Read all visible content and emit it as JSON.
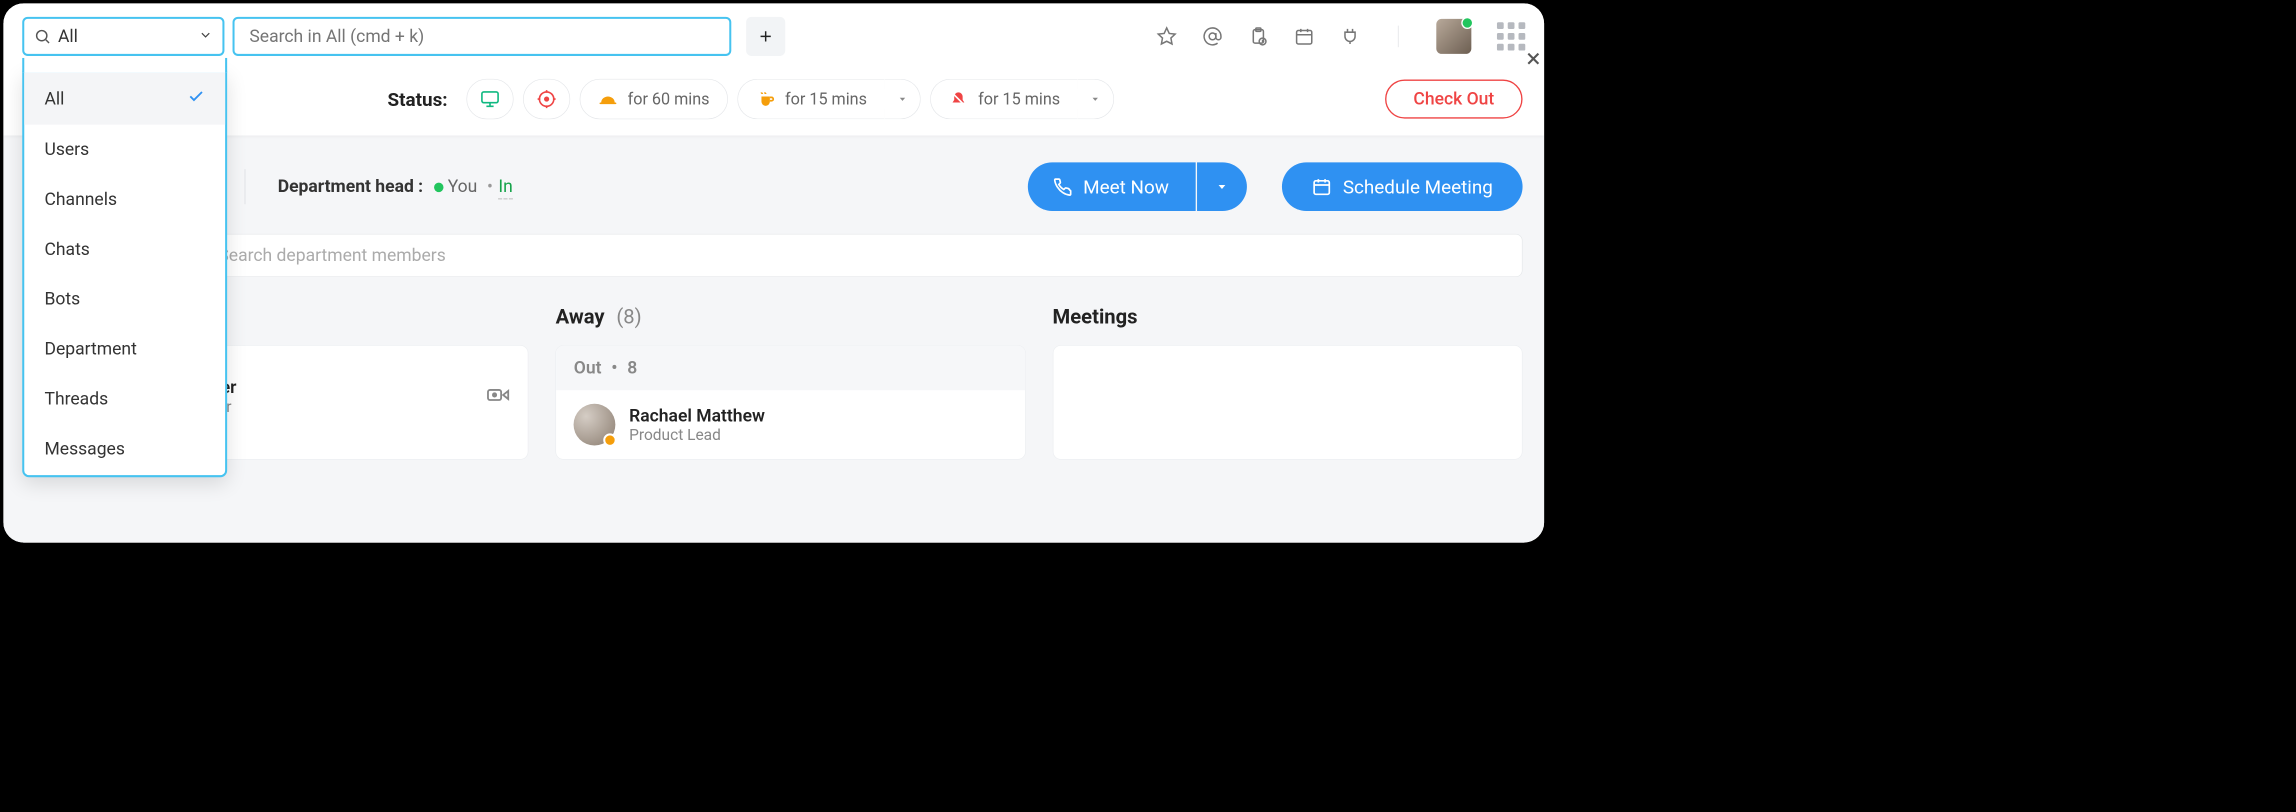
{
  "topbar": {
    "filter_selected": "All",
    "search_placeholder": "Search in All (cmd + k)",
    "dropdown_items": [
      "All",
      "Users",
      "Channels",
      "Chats",
      "Bots",
      "Department",
      "Threads",
      "Messages"
    ]
  },
  "status": {
    "label": "Status:",
    "options": [
      {
        "icon": "monitor",
        "text": ""
      },
      {
        "icon": "target",
        "text": ""
      },
      {
        "icon": "bell",
        "text": "for 60 mins"
      },
      {
        "icon": "coffee",
        "text": "for 15 mins"
      },
      {
        "icon": "notify-off",
        "text": "for 15 mins"
      }
    ],
    "check_out": "Check Out"
  },
  "dept": {
    "label": "Department head :",
    "you": "You",
    "in": "In",
    "meet_now": "Meet Now",
    "schedule": "Schedule Meeting"
  },
  "search_members_placeholder": "Search department members",
  "columns": {
    "away": {
      "title": "Away",
      "count": "(8)",
      "sub_label": "Out",
      "sub_count": "8"
    },
    "meetings": {
      "title": "Meetings"
    }
  },
  "people": {
    "col1": {
      "name": "Olivia Palmer",
      "role": "Content Writer"
    },
    "col2": {
      "name": "Rachael Matthew",
      "role": "Product Lead"
    }
  }
}
